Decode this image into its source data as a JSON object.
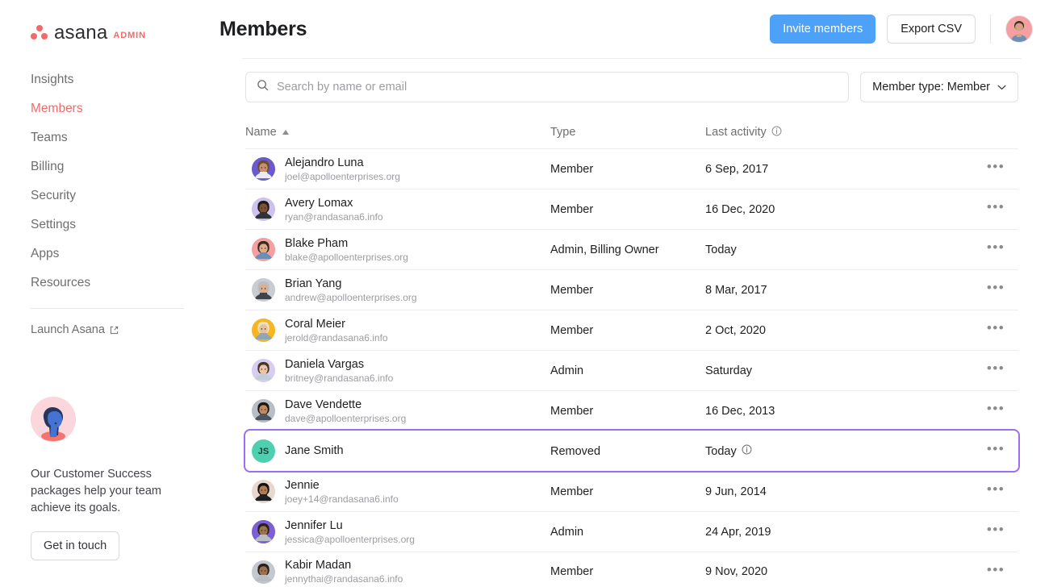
{
  "brand": {
    "name": "asana",
    "suffix": "ADMIN",
    "accent": "#f06a6a",
    "logo_icon": "asana-dots-logo"
  },
  "sidebar": {
    "items": [
      {
        "label": "Insights",
        "active": false
      },
      {
        "label": "Members",
        "active": true
      },
      {
        "label": "Teams",
        "active": false
      },
      {
        "label": "Billing",
        "active": false
      },
      {
        "label": "Security",
        "active": false
      },
      {
        "label": "Settings",
        "active": false
      },
      {
        "label": "Apps",
        "active": false
      },
      {
        "label": "Resources",
        "active": false
      }
    ],
    "launch": {
      "label": "Launch Asana",
      "icon": "external-link-icon"
    },
    "promo": {
      "text": "Our Customer Success packages help your team achieve its goals.",
      "button": "Get in touch",
      "illustration": "person-avatar-illustration"
    }
  },
  "header": {
    "title": "Members",
    "invite_label": "Invite members",
    "export_label": "Export CSV",
    "invite_color": "#4da2f7",
    "avatar": "user-profile-avatar"
  },
  "search": {
    "placeholder": "Search by name or email",
    "value": "",
    "icon": "search-icon"
  },
  "filter": {
    "label": "Member type: Member",
    "icon": "chevron-down-icon"
  },
  "table": {
    "columns": {
      "name": "Name",
      "type": "Type",
      "activity": "Last activity"
    },
    "sort": {
      "column": "Name",
      "direction": "asc",
      "icon": "caret-up-icon"
    },
    "activity_info_icon": "info-icon",
    "row_menu_glyph": "•••",
    "rows": [
      {
        "name": "Alejandro Luna",
        "email": "joel@apolloenterprises.org",
        "type": "Member",
        "activity": "6 Sep, 2017",
        "avatar_color": "#6a5acd",
        "avatar_kind": "photo",
        "initials": "",
        "has_info": false,
        "highlight": false
      },
      {
        "name": "Avery Lomax",
        "email": "ryan@randasana6.info",
        "type": "Member",
        "activity": "16 Dec, 2020",
        "avatar_color": "#cdc2ef",
        "avatar_kind": "photo",
        "initials": "",
        "has_info": false,
        "highlight": false
      },
      {
        "name": "Blake Pham",
        "email": "blake@apolloenterprises.org",
        "type": "Admin, Billing Owner",
        "activity": "Today",
        "avatar_color": "#f4a0a3",
        "avatar_kind": "photo",
        "initials": "",
        "has_info": false,
        "highlight": false
      },
      {
        "name": "Brian Yang",
        "email": "andrew@apolloenterprises.org",
        "type": "Member",
        "activity": "8 Mar, 2017",
        "avatar_color": "#c9ccd1",
        "avatar_kind": "photo",
        "initials": "",
        "has_info": false,
        "highlight": false
      },
      {
        "name": "Coral Meier",
        "email": "jerold@randasana6.info",
        "type": "Member",
        "activity": "2 Oct, 2020",
        "avatar_color": "#f5b621",
        "avatar_kind": "photo",
        "initials": "",
        "has_info": false,
        "highlight": false
      },
      {
        "name": "Daniela Vargas",
        "email": "britney@randasana6.info",
        "type": "Admin",
        "activity": "Saturday",
        "avatar_color": "#d6cdf0",
        "avatar_kind": "photo",
        "initials": "",
        "has_info": false,
        "highlight": false
      },
      {
        "name": "Dave Vendette",
        "email": "dave@apolloenterprises.org",
        "type": "Member",
        "activity": "16 Dec, 2013",
        "avatar_color": "#b9bec4",
        "avatar_kind": "photo",
        "initials": "",
        "has_info": false,
        "highlight": false
      },
      {
        "name": "Jane Smith",
        "email": "",
        "type": "Removed",
        "activity": "Today",
        "avatar_color": "#4dcfb0",
        "avatar_kind": "initials",
        "initials": "JS",
        "has_info": true,
        "highlight": true
      },
      {
        "name": "Jennie",
        "email": "joey+14@randasana6.info",
        "type": "Member",
        "activity": "9 Jun, 2014",
        "avatar_color": "#e7d7cc",
        "avatar_kind": "photo",
        "initials": "",
        "has_info": false,
        "highlight": false
      },
      {
        "name": "Jennifer Lu",
        "email": "jessica@apolloenterprises.org",
        "type": "Admin",
        "activity": "24 Apr, 2019",
        "avatar_color": "#7b5fd4",
        "avatar_kind": "photo",
        "initials": "",
        "has_info": false,
        "highlight": false
      },
      {
        "name": "Kabir Madan",
        "email": "jennythai@randasana6.info",
        "type": "Member",
        "activity": "9 Nov, 2020",
        "avatar_color": "#c3c8cf",
        "avatar_kind": "photo",
        "initials": "",
        "has_info": false,
        "highlight": false
      }
    ]
  },
  "highlight_color": "#9b6ef3"
}
